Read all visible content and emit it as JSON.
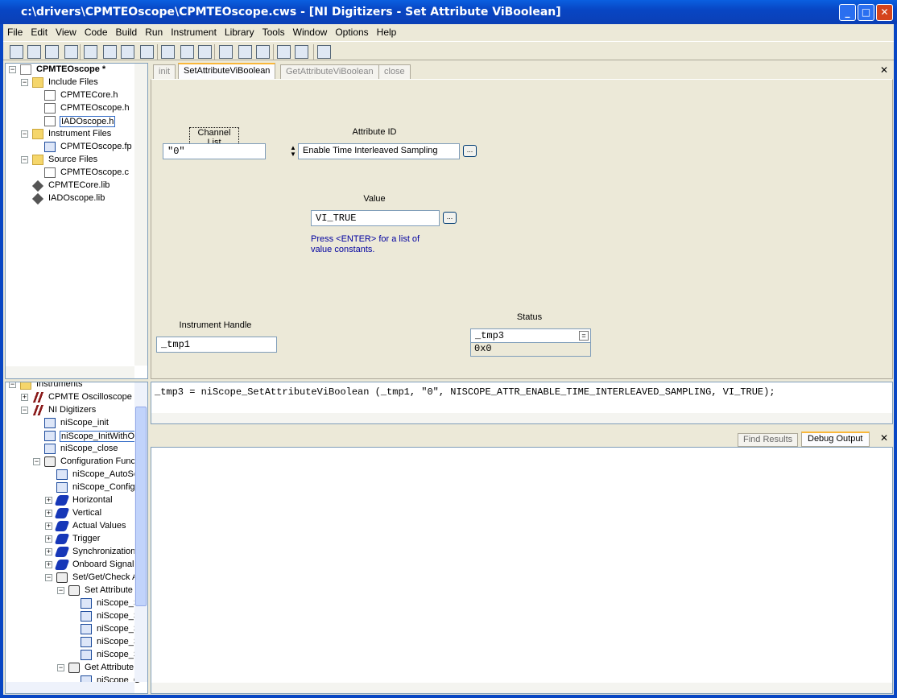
{
  "window": {
    "title": "c:\\drivers\\CPMTEOscope\\CPMTEOscope.cws - [NI Digitizers - Set Attribute ViBoolean]",
    "min": "_",
    "max": "□",
    "close": "✕"
  },
  "menu": [
    "File",
    "Edit",
    "View",
    "Code",
    "Build",
    "Run",
    "Instrument",
    "Library",
    "Tools",
    "Window",
    "Options",
    "Help"
  ],
  "project_tree": [
    {
      "level": 0,
      "exp": "-",
      "icon": "proj",
      "text": "CPMTEOscope *",
      "bold": true
    },
    {
      "level": 1,
      "exp": "-",
      "icon": "folder",
      "text": "Include Files"
    },
    {
      "level": 2,
      "icon": "file",
      "text": "CPMTECore.h"
    },
    {
      "level": 2,
      "icon": "file",
      "text": "CPMTEOscope.h"
    },
    {
      "level": 2,
      "icon": "file",
      "text": "IADOscope.h",
      "selected": true
    },
    {
      "level": 1,
      "exp": "-",
      "icon": "folder",
      "text": "Instrument Files"
    },
    {
      "level": 2,
      "icon": "fp",
      "text": "CPMTEOscope.fp"
    },
    {
      "level": 1,
      "exp": "-",
      "icon": "folder",
      "text": "Source Files"
    },
    {
      "level": 2,
      "icon": "file",
      "text": "CPMTEOscope.c"
    },
    {
      "level": 1,
      "icon": "lib",
      "text": "CPMTECore.lib"
    },
    {
      "level": 1,
      "icon": "lib",
      "text": "IADOscope.lib"
    }
  ],
  "library_tree": [
    {
      "level": 0,
      "exp": "-",
      "icon": "folder",
      "text": "Instruments"
    },
    {
      "level": 1,
      "exp": "+",
      "icon": "instr",
      "text": "CPMTE Oscilloscope"
    },
    {
      "level": 1,
      "exp": "-",
      "icon": "instr",
      "text": "NI Digitizers"
    },
    {
      "level": 2,
      "icon": "fp",
      "text": "niScope_init"
    },
    {
      "level": 2,
      "icon": "fp",
      "text": "niScope_InitWithOp",
      "selected": true
    },
    {
      "level": 2,
      "icon": "fp",
      "text": "niScope_close"
    },
    {
      "level": 2,
      "exp": "-",
      "icon": "openbook",
      "text": "Configuration Functi"
    },
    {
      "level": 3,
      "icon": "fp",
      "text": "niScope_AutoSe"
    },
    {
      "level": 3,
      "icon": "fp",
      "text": "niScope_Configu"
    },
    {
      "level": 3,
      "exp": "+",
      "icon": "book",
      "text": "Horizontal"
    },
    {
      "level": 3,
      "exp": "+",
      "icon": "book",
      "text": "Vertical"
    },
    {
      "level": 3,
      "exp": "+",
      "icon": "book",
      "text": "Actual Values"
    },
    {
      "level": 3,
      "exp": "+",
      "icon": "book",
      "text": "Trigger"
    },
    {
      "level": 3,
      "exp": "+",
      "icon": "book",
      "text": "Synchronization"
    },
    {
      "level": 3,
      "exp": "+",
      "icon": "book",
      "text": "Onboard Signal F"
    },
    {
      "level": 3,
      "exp": "-",
      "icon": "openbook",
      "text": "Set/Get/Check A"
    },
    {
      "level": 4,
      "exp": "-",
      "icon": "openbook",
      "text": "Set Attribute"
    },
    {
      "level": 5,
      "icon": "fp",
      "text": "niScope_S"
    },
    {
      "level": 5,
      "icon": "fp",
      "text": "niScope_S"
    },
    {
      "level": 5,
      "icon": "fp",
      "text": "niScope_S"
    },
    {
      "level": 5,
      "icon": "fp",
      "text": "niScope_S"
    },
    {
      "level": 5,
      "icon": "fp",
      "text": "niScope_S"
    },
    {
      "level": 4,
      "exp": "-",
      "icon": "openbook",
      "text": "Get Attribute"
    },
    {
      "level": 5,
      "icon": "fp",
      "text": "niScope_G"
    }
  ],
  "tabs": {
    "init": "init",
    "set": "SetAttributeViBoolean",
    "get": "GetAttributeViBoolean",
    "close": "close"
  },
  "panel": {
    "channel_label": "Channel List",
    "channel_value": "\"0\"",
    "attr_label": "Attribute ID",
    "attr_value": "Enable Time Interleaved Sampling",
    "value_label": "Value",
    "value_value": "VI_TRUE",
    "value_hint": "Press <ENTER> for a list of value constants.",
    "handle_label": "Instrument Handle",
    "handle_value": "_tmp1",
    "status_label": "Status",
    "status_var": "_tmp3",
    "status_value": "0x0",
    "ellipsis": "..."
  },
  "code_line": "_tmp3 = niScope_SetAttributeViBoolean (_tmp1, \"0\", NISCOPE_ATTR_ENABLE_TIME_INTERLEAVED_SAMPLING, VI_TRUE);",
  "output_tabs": {
    "find": "Find Results",
    "debug": "Debug Output"
  },
  "close_x": "✕"
}
